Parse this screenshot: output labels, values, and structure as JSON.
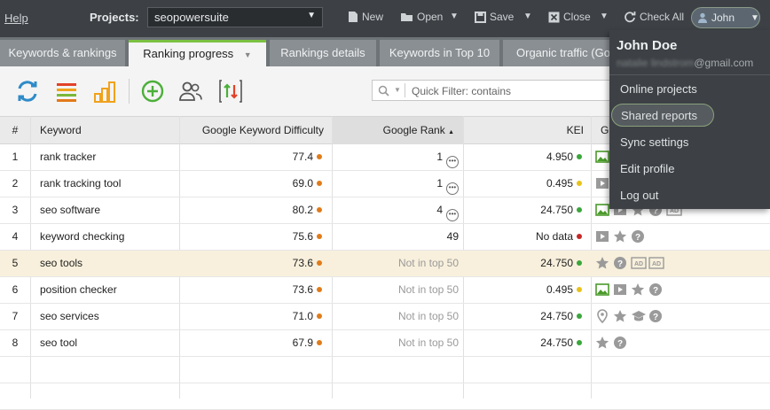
{
  "topbar": {
    "help": "Help",
    "projects_label": "Projects:",
    "project_value": "seopowersuite",
    "new": "New",
    "open": "Open",
    "save": "Save",
    "close": "Close",
    "check_all": "Check All",
    "user": "John"
  },
  "tabs": [
    {
      "label": "Keywords & rankings"
    },
    {
      "label": "Ranking progress"
    },
    {
      "label": "Rankings details"
    },
    {
      "label": "Keywords in Top 10"
    },
    {
      "label": "Organic traffic (Goo"
    }
  ],
  "filter": {
    "placeholder": "Quick Filter: contains"
  },
  "table": {
    "headers": {
      "num": "#",
      "keyword": "Keyword",
      "difficulty": "Google Keyword Difficulty",
      "rank": "Google Rank",
      "kei": "KEI",
      "features": "G"
    },
    "rows": [
      {
        "num": "1",
        "keyword": "rank tracker",
        "difficulty": "77.4",
        "rank": "1",
        "kei": "4.950"
      },
      {
        "num": "2",
        "keyword": "rank tracking tool",
        "difficulty": "69.0",
        "rank": "1",
        "kei": "0.495"
      },
      {
        "num": "3",
        "keyword": "seo software",
        "difficulty": "80.2",
        "rank": "4",
        "kei": "24.750"
      },
      {
        "num": "4",
        "keyword": "keyword checking",
        "difficulty": "75.6",
        "rank": "49",
        "kei": "No data"
      },
      {
        "num": "5",
        "keyword": "seo tools",
        "difficulty": "73.6",
        "rank": "Not in top 50",
        "kei": "24.750"
      },
      {
        "num": "6",
        "keyword": "position checker",
        "difficulty": "73.6",
        "rank": "Not in top 50",
        "kei": "0.495"
      },
      {
        "num": "7",
        "keyword": "seo services",
        "difficulty": "71.0",
        "rank": "Not in top 50",
        "kei": "24.750"
      },
      {
        "num": "8",
        "keyword": "seo tool",
        "difficulty": "67.9",
        "rank": "Not in top 50",
        "kei": "24.750"
      }
    ]
  },
  "menu": {
    "name": "John Doe",
    "email_hidden": "natalie lindstrom",
    "email_domain": "@gmail.com",
    "items": [
      {
        "label": "Online projects"
      },
      {
        "label": "Shared reports"
      },
      {
        "label": "Sync settings"
      },
      {
        "label": "Edit profile"
      },
      {
        "label": "Log out"
      }
    ]
  },
  "colors": {
    "orange_dot": "#e07b1a",
    "green_dot": "#3aa63a",
    "yellow_dot": "#e8c21a",
    "red_dot": "#c62828",
    "accent": "#7bc142"
  }
}
